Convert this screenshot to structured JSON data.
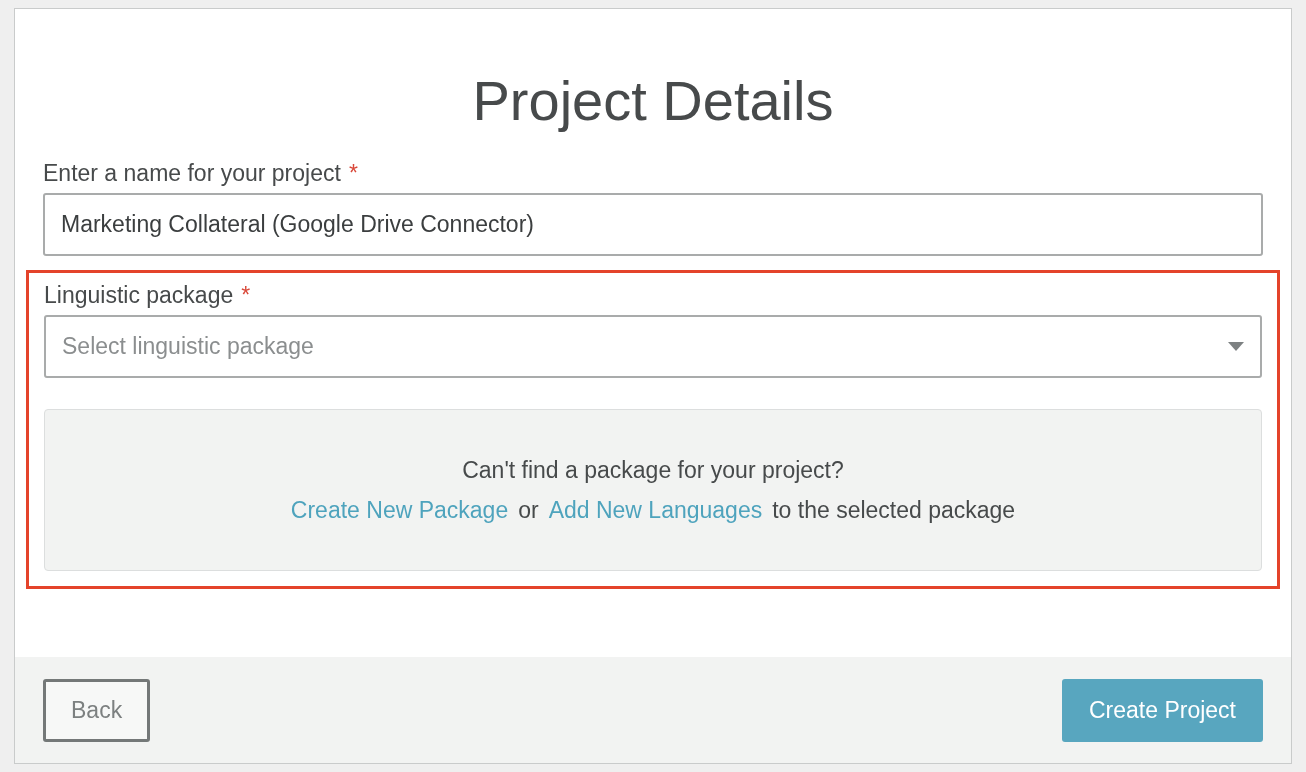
{
  "title": "Project Details",
  "name_field": {
    "label": "Enter a name for your project",
    "required_mark": "*",
    "value": "Marketing Collateral (Google Drive Connector)"
  },
  "package_field": {
    "label": "Linguistic package",
    "required_mark": "*",
    "placeholder": "Select linguistic package"
  },
  "hint": {
    "question": "Can't find a package for your project?",
    "link_1": "Create New Package",
    "between": "or",
    "link_2": "Add New Languages",
    "tail": "to the selected package"
  },
  "buttons": [
    {
      "label": "Back",
      "kind": "secondary"
    },
    {
      "label": "Create Project",
      "kind": "primary"
    }
  ]
}
